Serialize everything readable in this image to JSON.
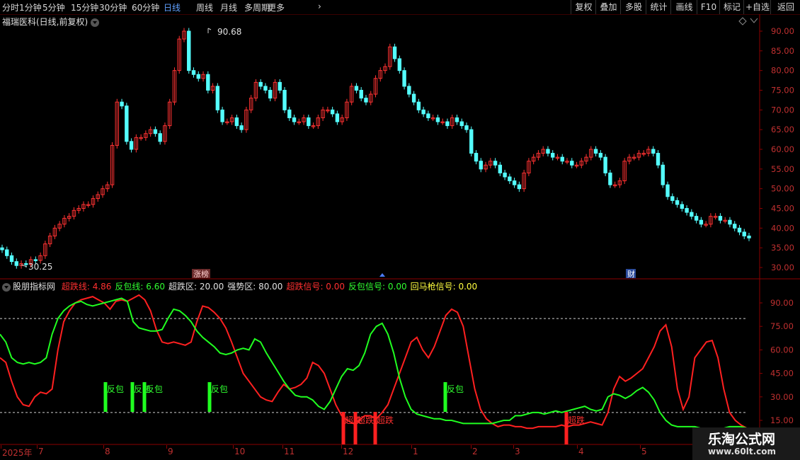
{
  "toolbar": {
    "periods": [
      "分时",
      "1分钟",
      "5分钟",
      "15分钟",
      "30分钟",
      "60分钟",
      "日线",
      "周线",
      "月线",
      "多周期",
      "更多"
    ],
    "right_buttons": [
      "复权",
      "叠加",
      "多股",
      "统计",
      "画线",
      "F10",
      "标记",
      "+自选",
      "返回"
    ]
  },
  "stock": {
    "title": "福瑞医科(日线,前复权)",
    "high_label": "90.68",
    "low_label": "30.25",
    "tag_limit_up": "涨榜",
    "tag_finance": "财"
  },
  "price_axis": [
    "90.00",
    "85.00",
    "80.00",
    "75.00",
    "70.00",
    "65.00",
    "60.00",
    "55.00",
    "50.00",
    "45.00",
    "40.00",
    "35.00",
    "30.00"
  ],
  "indicator": {
    "name": "股朋指标网",
    "fields": [
      {
        "text": "超跌线: 4.86",
        "color": "#ff3030"
      },
      {
        "text": "反包线: 6.60",
        "color": "#30ff30"
      },
      {
        "text": "超跌区: 20.00",
        "color": "#e0e0e0"
      },
      {
        "text": "强势区: 80.00",
        "color": "#e0e0e0"
      },
      {
        "text": "超跌信号: 0.00",
        "color": "#ff3030"
      },
      {
        "text": "反包信号: 0.00",
        "color": "#30ff30"
      },
      {
        "text": "回马枪信号: 0.00",
        "color": "#ffff40"
      }
    ],
    "axis": [
      "90.00",
      "75.00",
      "60.00",
      "45.00",
      "30.00",
      "15.00"
    ],
    "signal_fanbao": "反包",
    "signal_chaodie": "超跌"
  },
  "time_axis": [
    "2025年",
    "7",
    "8",
    "9",
    "10",
    "11",
    "12",
    "1",
    "2",
    "3",
    "4",
    "5"
  ],
  "watermark": {
    "line1": "乐淘公式网",
    "line2": "www.60lt.com"
  },
  "colors": {
    "up": "#ff3232",
    "down": "#54ffff",
    "red_line": "#ff2020",
    "green_line": "#20ff20",
    "grid": "#8b0000"
  },
  "chart_data": [
    {
      "type": "candlestick",
      "title": "福瑞医科(日线,前复权)",
      "ylim": [
        28,
        93
      ],
      "annotations": {
        "high": 90.68,
        "low": 30.25
      },
      "close_path": [
        34.5,
        33,
        31.5,
        30.5,
        31,
        30.8,
        32,
        31.8,
        33,
        36,
        38,
        40,
        41,
        42.5,
        43,
        44.5,
        45,
        46,
        46,
        47.5,
        48.5,
        50,
        51,
        61,
        72,
        71,
        62,
        60,
        63,
        63,
        64,
        65,
        64,
        62,
        66,
        72,
        80,
        88,
        90,
        80,
        79,
        78,
        79,
        75,
        76,
        70,
        67,
        67,
        68,
        66,
        65,
        70,
        73,
        77,
        76,
        75,
        73,
        77,
        75,
        70,
        68,
        67,
        67,
        68,
        66,
        66,
        68,
        70,
        70,
        69,
        67,
        68,
        72,
        76,
        75,
        73,
        72,
        74,
        78,
        80,
        81,
        86,
        83,
        80,
        76,
        74,
        72,
        70,
        69,
        68,
        68,
        67,
        67,
        66,
        68,
        67,
        66,
        65,
        59,
        57,
        55,
        56,
        57,
        56,
        54,
        53,
        52,
        51,
        50,
        54,
        57,
        58,
        59,
        60,
        59,
        58,
        58,
        57,
        57,
        56,
        56,
        57,
        58,
        60,
        59,
        58,
        54,
        51,
        51,
        52,
        57,
        58,
        58,
        59,
        59,
        60,
        59,
        56,
        51,
        48,
        47,
        46,
        45,
        44,
        43,
        42,
        41,
        41,
        43,
        43,
        42,
        42,
        41,
        40,
        39,
        38,
        37.5
      ]
    },
    {
      "type": "line",
      "title": "股朋指标网",
      "ylim": [
        10,
        99
      ],
      "reference_lines": [
        20,
        80
      ],
      "series": [
        {
          "name": "超跌线",
          "values": [
            55,
            52,
            40,
            30,
            25,
            24,
            30,
            33,
            32,
            35,
            60,
            78,
            85,
            90,
            92,
            93,
            94,
            92,
            90,
            86,
            91,
            92,
            91,
            93,
            95,
            92,
            85,
            73,
            65,
            64,
            65,
            64,
            63,
            65,
            78,
            88,
            87,
            84,
            80,
            74,
            65,
            55,
            45,
            40,
            35,
            30,
            28,
            27,
            33,
            38,
            35,
            36,
            38,
            42,
            52,
            50,
            45,
            35,
            25,
            18,
            15,
            13,
            15,
            18,
            18,
            16,
            20,
            25,
            35,
            45,
            55,
            65,
            68,
            60,
            55,
            62,
            72,
            82,
            86,
            84,
            75,
            55,
            35,
            22,
            16,
            13,
            11,
            12,
            12,
            11,
            11,
            10,
            10,
            11,
            11,
            11,
            11,
            12,
            11,
            12,
            12,
            13,
            14,
            13,
            12,
            20,
            35,
            43,
            40,
            42,
            45,
            48,
            55,
            62,
            72,
            76,
            62,
            35,
            22,
            30,
            55,
            60,
            65,
            66,
            55,
            35,
            20,
            15,
            12,
            10
          ]
        },
        {
          "name": "反包线",
          "values": [
            70,
            65,
            55,
            52,
            51,
            52,
            51,
            52,
            55,
            70,
            80,
            85,
            88,
            90,
            91,
            89,
            88,
            89,
            90,
            91,
            92,
            93,
            91,
            78,
            74,
            73,
            72,
            72,
            73,
            80,
            86,
            85,
            82,
            78,
            72,
            68,
            65,
            62,
            58,
            57,
            58,
            60,
            61,
            60,
            67,
            65,
            58,
            52,
            46,
            40,
            35,
            31,
            30,
            30,
            28,
            24,
            22,
            27,
            35,
            43,
            48,
            47,
            50,
            58,
            70,
            75,
            77,
            70,
            58,
            42,
            30,
            22,
            19,
            18,
            17,
            16,
            16,
            15,
            15,
            14,
            13,
            13,
            13,
            13,
            13,
            13,
            14,
            15,
            15,
            18,
            18,
            19,
            20,
            20,
            19,
            20,
            21,
            20,
            21,
            22,
            23,
            24,
            22,
            21,
            22,
            30,
            32,
            31,
            29,
            31,
            34,
            36,
            33,
            28,
            20,
            15,
            12,
            11,
            11,
            11,
            11,
            10,
            10,
            10,
            10,
            10,
            11,
            11,
            11,
            10
          ]
        }
      ],
      "signals": {
        "反包": [
          5,
          11,
          13,
          19,
          43
        ],
        "超跌": [
          31,
          32,
          34,
          55
        ]
      }
    }
  ]
}
